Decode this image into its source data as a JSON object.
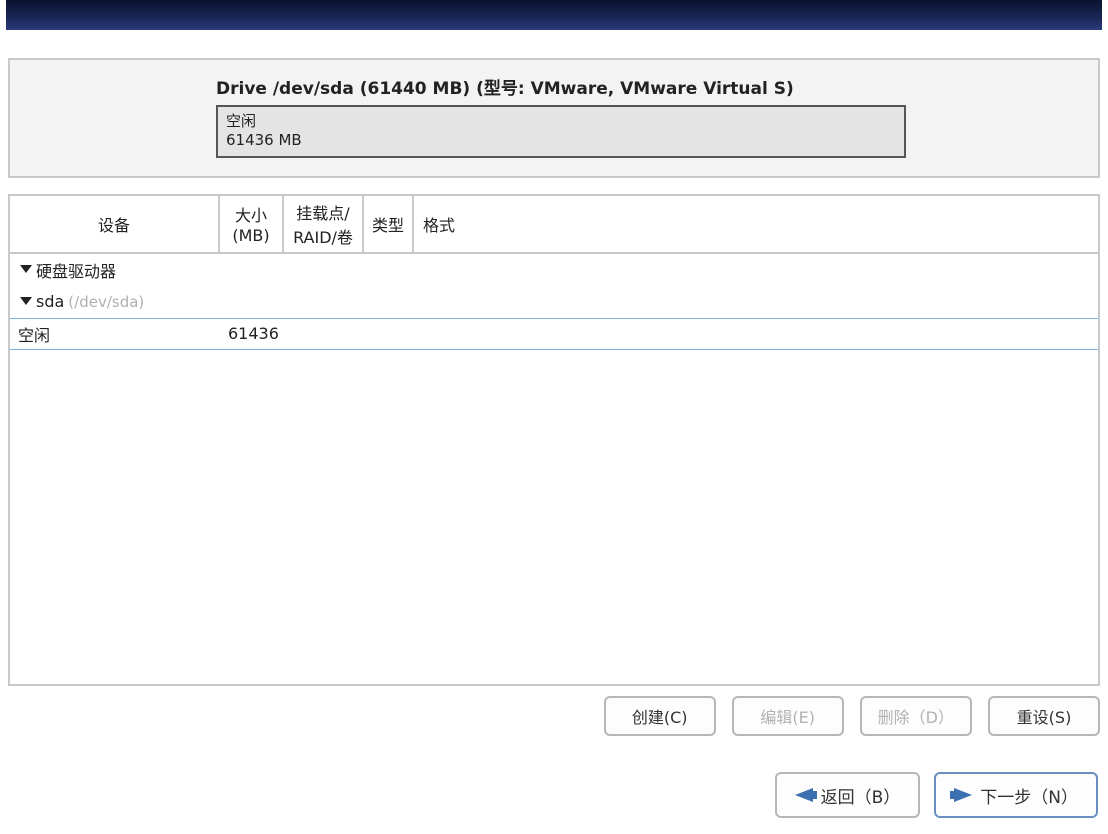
{
  "drive_panel": {
    "title": "Drive /dev/sda (61440 MB) (型号: VMware, VMware Virtual S)",
    "free_label": "空闲",
    "free_size": "61436 MB"
  },
  "columns": {
    "device": "设备",
    "size_line1": "大小",
    "size_line2": "(MB)",
    "mount_line1": "挂载点/",
    "mount_line2": "RAID/卷",
    "type": "类型",
    "format": "格式"
  },
  "tree": {
    "root_label": "硬盘驱动器",
    "sda_label": "sda",
    "sda_path": "(/dev/sda)",
    "free_label": "空闲",
    "free_size": "61436"
  },
  "buttons": {
    "create": "创建(C)",
    "edit": "编辑(E)",
    "delete": "删除（D）",
    "reset": "重设(S)"
  },
  "nav": {
    "back": "返回（B）",
    "next": "下一步（N）"
  }
}
